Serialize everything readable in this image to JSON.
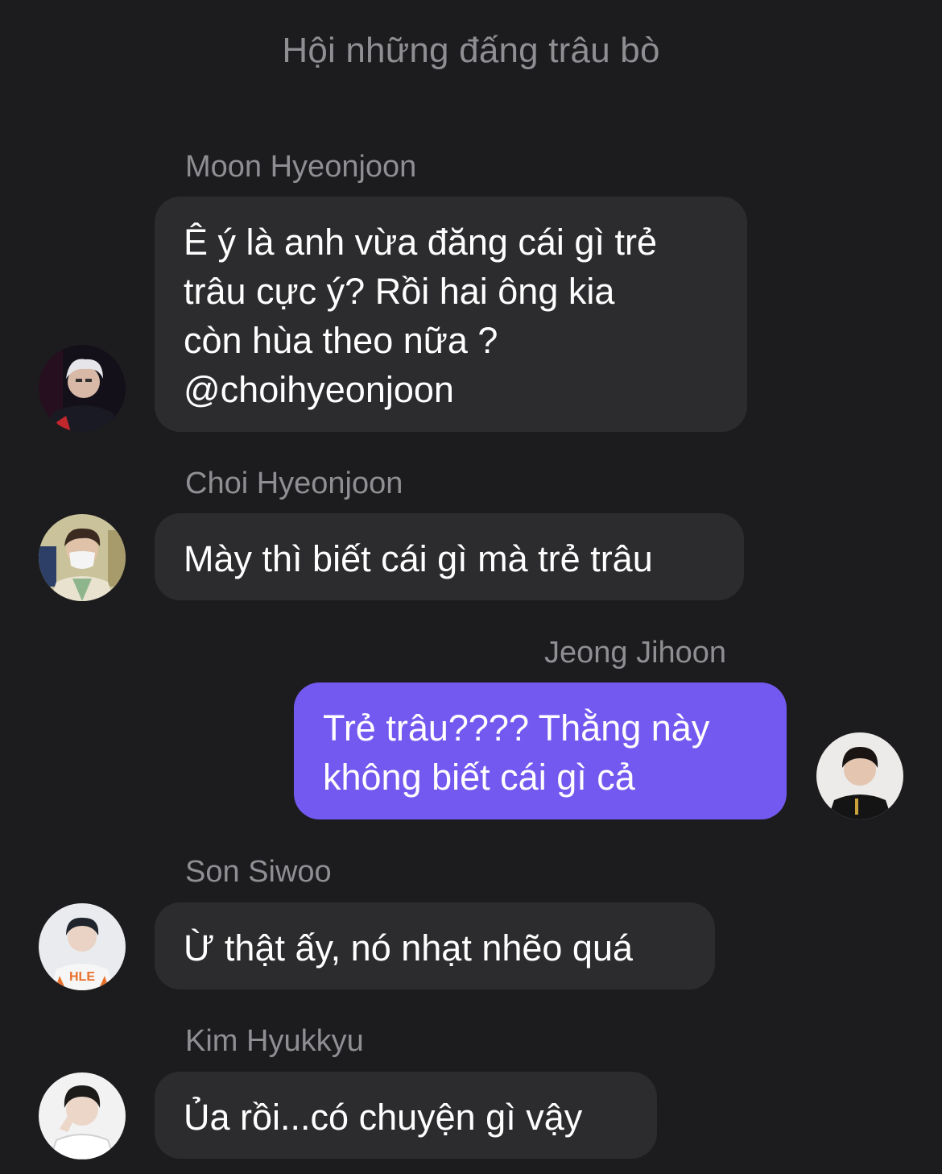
{
  "header": {
    "title": "Hội những đấng trâu bò"
  },
  "messages": [
    {
      "sender": "Moon Hyeonjoon",
      "text": "Ê ý là anh vừa đăng cái gì trẻ\ntrâu cực ý? Rồi hai ông kia\ncòn hùa theo nữa ?\n@choihyeonjoon",
      "direction": "incoming",
      "avatar_icon": "profile-photo-icon"
    },
    {
      "sender": "Choi Hyeonjoon",
      "text": "Mày thì biết cái gì mà trẻ trâu",
      "direction": "incoming",
      "avatar_icon": "profile-photo-icon"
    },
    {
      "sender": "Jeong Jihoon",
      "text": "Trẻ trâu???? Thằng này\nkhông biết cái gì cả",
      "direction": "outgoing",
      "avatar_icon": "profile-photo-icon"
    },
    {
      "sender": "Son Siwoo",
      "text": "Ừ thật ấy, nó nhạt nhẽo quá",
      "direction": "incoming",
      "avatar_icon": "profile-photo-icon",
      "avatar_shirt_text": "HLE"
    },
    {
      "sender": "Kim Hyukkyu",
      "text": "Ủa rồi...có chuyện gì vậy",
      "direction": "incoming",
      "avatar_icon": "profile-photo-icon"
    }
  ],
  "colors": {
    "background": "#1c1c1e",
    "incoming_bubble": "#2c2c2e",
    "outgoing_bubble": "#7459f0",
    "secondary_text": "#8e8e93",
    "primary_text": "#ffffff"
  }
}
